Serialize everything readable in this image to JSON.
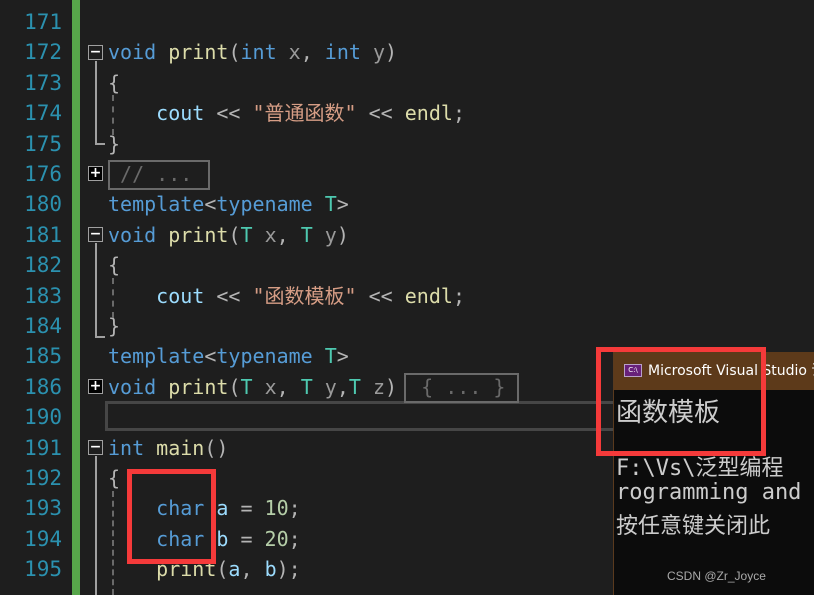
{
  "editor": {
    "lines": [
      {
        "num": "171",
        "tokens": []
      },
      {
        "num": "172",
        "tokens": [
          [
            "void",
            "k"
          ],
          [
            " ",
            ""
          ],
          [
            "print",
            "f"
          ],
          [
            "(",
            "o"
          ],
          [
            "int",
            "k"
          ],
          [
            " x",
            "p"
          ],
          [
            ", ",
            "o"
          ],
          [
            "int",
            "k"
          ],
          [
            " y",
            "p"
          ],
          [
            ")",
            "o"
          ]
        ]
      },
      {
        "num": "173",
        "tokens": [
          [
            "{",
            "o"
          ]
        ]
      },
      {
        "num": "174",
        "tokens": [
          [
            "    cout",
            "v"
          ],
          [
            " << ",
            "o"
          ],
          [
            "\"普通函数\"",
            "s"
          ],
          [
            " << ",
            "o"
          ],
          [
            "endl",
            "f"
          ],
          [
            ";",
            "o"
          ]
        ]
      },
      {
        "num": "175",
        "tokens": [
          [
            "}",
            "o"
          ]
        ]
      },
      {
        "num": "176",
        "tokens": [
          [
            " // ... ",
            "c"
          ]
        ]
      },
      {
        "num": "180",
        "tokens": [
          [
            "template",
            "k"
          ],
          [
            "<",
            "o"
          ],
          [
            "typename",
            "k"
          ],
          [
            " ",
            ""
          ],
          [
            "T",
            "t"
          ],
          [
            ">",
            "o"
          ]
        ]
      },
      {
        "num": "181",
        "tokens": [
          [
            "void",
            "k"
          ],
          [
            " ",
            ""
          ],
          [
            "print",
            "f"
          ],
          [
            "(",
            "o"
          ],
          [
            "T",
            "t"
          ],
          [
            " x",
            "p"
          ],
          [
            ", ",
            "o"
          ],
          [
            "T",
            "t"
          ],
          [
            " y",
            "p"
          ],
          [
            ")",
            "o"
          ]
        ]
      },
      {
        "num": "182",
        "tokens": [
          [
            "{",
            "o"
          ]
        ]
      },
      {
        "num": "183",
        "tokens": [
          [
            "    cout",
            "v"
          ],
          [
            " << ",
            "o"
          ],
          [
            "\"函数模板\"",
            "s"
          ],
          [
            " << ",
            "o"
          ],
          [
            "endl",
            "f"
          ],
          [
            ";",
            "o"
          ]
        ]
      },
      {
        "num": "184",
        "tokens": [
          [
            "}",
            "o"
          ]
        ]
      },
      {
        "num": "185",
        "tokens": [
          [
            "template",
            "k"
          ],
          [
            "<",
            "o"
          ],
          [
            "typename",
            "k"
          ],
          [
            " ",
            ""
          ],
          [
            "T",
            "t"
          ],
          [
            ">",
            "o"
          ]
        ]
      },
      {
        "num": "186",
        "tokens": [
          [
            "void",
            "k"
          ],
          [
            " ",
            ""
          ],
          [
            "print",
            "f"
          ],
          [
            "(",
            "o"
          ],
          [
            "T",
            "t"
          ],
          [
            " x",
            "p"
          ],
          [
            ", ",
            "o"
          ],
          [
            "T",
            "t"
          ],
          [
            " y",
            "p"
          ],
          [
            ",",
            "o"
          ],
          [
            "T",
            "t"
          ],
          [
            " z",
            "p"
          ],
          [
            ")",
            "o"
          ],
          [
            "  { ... } ",
            "c"
          ]
        ]
      },
      {
        "num": "190",
        "tokens": []
      },
      {
        "num": "191",
        "tokens": [
          [
            "int",
            "k"
          ],
          [
            " ",
            ""
          ],
          [
            "main",
            "f"
          ],
          [
            "()",
            "o"
          ]
        ]
      },
      {
        "num": "192",
        "tokens": [
          [
            "{",
            "o"
          ]
        ]
      },
      {
        "num": "193",
        "tokens": [
          [
            "    char",
            "k"
          ],
          [
            " a",
            "v"
          ],
          [
            " = ",
            "o"
          ],
          [
            "10",
            "n"
          ],
          [
            ";",
            "o"
          ]
        ]
      },
      {
        "num": "194",
        "tokens": [
          [
            "    char",
            "k"
          ],
          [
            " b",
            "v"
          ],
          [
            " = ",
            "o"
          ],
          [
            "20",
            "n"
          ],
          [
            ";",
            "o"
          ]
        ]
      },
      {
        "num": "195",
        "tokens": [
          [
            "    print",
            "f"
          ],
          [
            "(",
            "o"
          ],
          [
            "a",
            "v"
          ],
          [
            ", ",
            "o"
          ],
          [
            "b",
            "v"
          ],
          [
            ");",
            "o"
          ]
        ]
      }
    ]
  },
  "console": {
    "title": "Microsoft Visual Studio 调",
    "icon": "console-app-icon",
    "lines": [
      "函数模板",
      "",
      "F:\\Vs\\泛型编程",
      "rogramming and",
      "按任意键关闭此"
    ]
  },
  "watermark": "CSDN @Zr_Joyce",
  "colors": {
    "keyword": "#569cd6",
    "string": "#d69d85",
    "type": "#4ec9b0",
    "highlight": "#f53a3a",
    "changebar": "#57a64a"
  }
}
